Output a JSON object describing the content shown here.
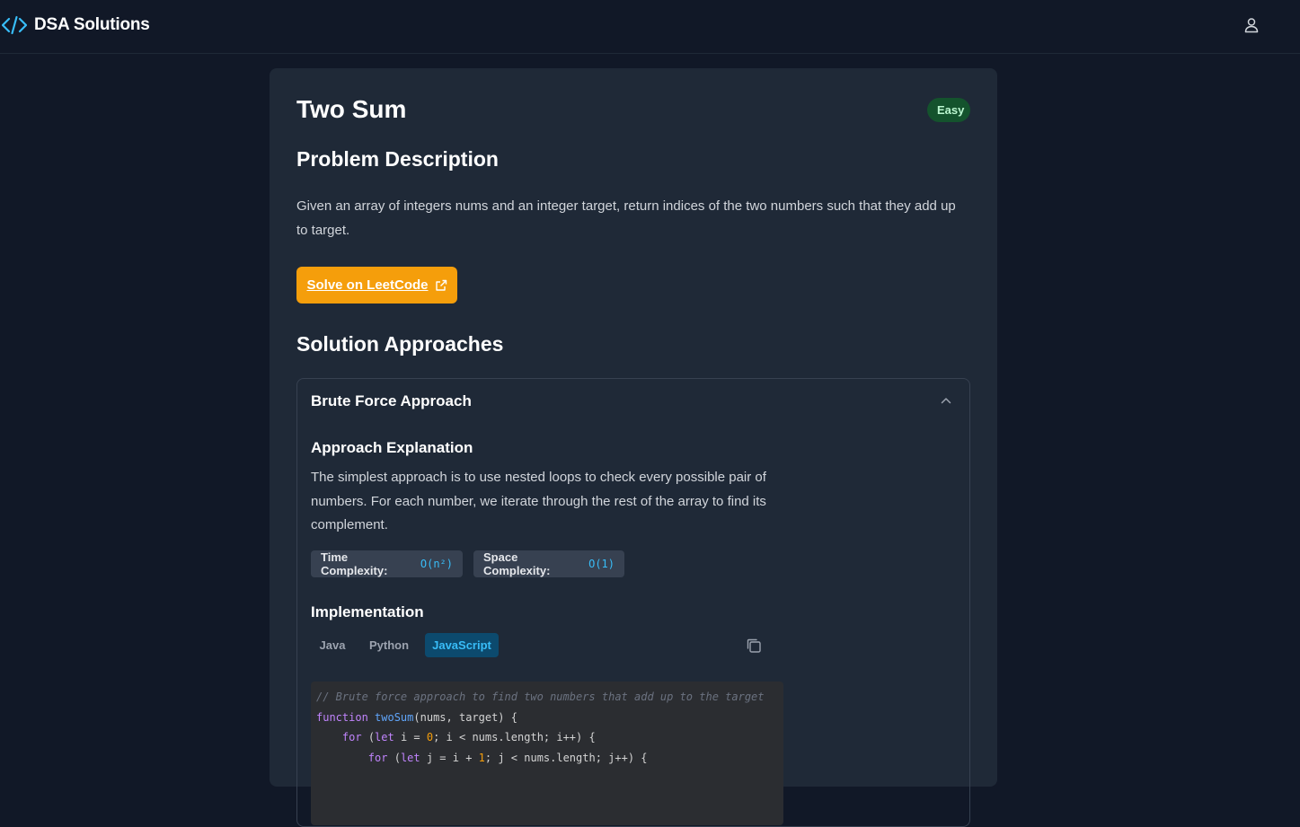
{
  "header": {
    "brand": "DSA Solutions",
    "logo_icon": "code-brackets-icon",
    "user_icon": "user-icon"
  },
  "problem": {
    "title": "Two Sum",
    "difficulty": "Easy",
    "description_heading": "Problem Description",
    "description": "Given an array of integers nums and an integer target, return indices of the two numbers such that they add up to target.",
    "leetcode_button": "Solve on LeetCode",
    "solutions_heading": "Solution Approaches"
  },
  "approach": {
    "title": "Brute Force Approach",
    "explanation_heading": "Approach Explanation",
    "explanation": "The simplest approach is to use nested loops to check every possible pair of numbers. For each number, we iterate through the rest of the array to find its complement.",
    "time_label": "Time Complexity:",
    "time_value": "O(n²)",
    "space_label": "Space Complexity:",
    "space_value": "O(1)",
    "implementation_heading": "Implementation",
    "tabs": [
      "Java",
      "Python",
      "JavaScript"
    ],
    "active_tab": "JavaScript",
    "code_lines": [
      "// Brute force approach to find two numbers that add up to the target",
      "function twoSum(nums, target) {",
      "    for (let i = 0; i < nums.length; i++) {",
      "        for (let j = i + 1; j < nums.length; j++) {"
    ]
  },
  "colors": {
    "background": "#111827",
    "card": "#1f2937",
    "accent": "#f59e0b",
    "link_blue": "#38bdf8",
    "easy_badge": "#14532d"
  }
}
